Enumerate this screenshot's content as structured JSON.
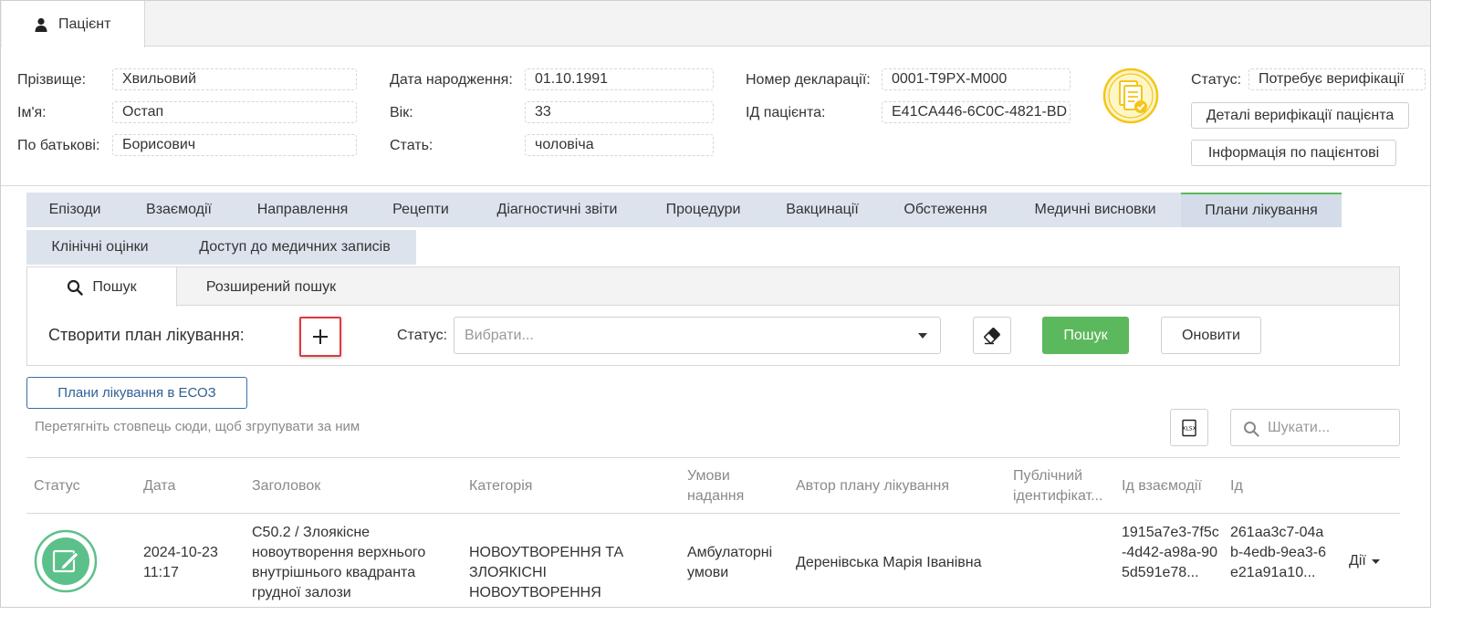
{
  "top_tab": {
    "label": "Пацієнт"
  },
  "patient": {
    "surname_label": "Прізвище:",
    "surname": "Хвильовий",
    "name_label": "Ім'я:",
    "name": "Остап",
    "patronymic_label": "По батькові:",
    "patronymic": "Борисович",
    "dob_label": "Дата народження:",
    "dob": "01.10.1991",
    "age_label": "Вік:",
    "age": "33",
    "sex_label": "Стать:",
    "sex": "чоловіча",
    "declaration_label": "Номер декларації:",
    "declaration": "0001-T9PX-M000",
    "patient_id_label": "ІД пацієнта:",
    "patient_id": "E41CA446-6C0C-4821-BD",
    "status_label": "Статус:",
    "status": "Потребує верифікації",
    "verification_details_button": "Деталі верифікації пацієнта",
    "patient_info_button": "Інформація по пацієнтові"
  },
  "section_tabs_row1": [
    "Епізоди",
    "Взаємодії",
    "Направлення",
    "Рецепти",
    "Діагностичні звіти",
    "Процедури",
    "Вакцинації",
    "Обстеження",
    "Медичні висновки",
    "Плани лікування"
  ],
  "section_tabs_row2": [
    "Клінічні оцінки",
    "Доступ до медичних записів"
  ],
  "active_section_tab": "Плани лікування",
  "search_panel": {
    "tab_search": "Пошук",
    "tab_advanced": "Розширений пошук",
    "create_label": "Створити план лікування:",
    "status_label": "Статус:",
    "status_placeholder": "Вибрати...",
    "search_button": "Пошук",
    "refresh_button": "Оновити"
  },
  "eso_button": "Плани лікування в ЕСОЗ",
  "group_hint": "Перетягніть стовпець сюди, щоб згрупувати за ним",
  "grid_search_placeholder": "Шукати...",
  "grid": {
    "columns": [
      "Статус",
      "Дата",
      "Заголовок",
      "Категорія",
      "Умови надання",
      "Автор плану лікування",
      "Публічний ідентифікат...",
      "Ід взаємодії",
      "Ід"
    ],
    "rows": [
      {
        "status_icon": "edit-icon",
        "date": "2024-10-23 11:17",
        "title": "C50.2 / Злоякісне новоутворення верхнього внутрішнього квадранта грудної залози",
        "category": "НОВОУТВОРЕННЯ ТА ЗЛОЯКІСНІ НОВОУТВОРЕННЯ",
        "conditions": "Амбулаторні умови",
        "author": "Деренівська Марія Іванівна",
        "public_id": "",
        "interaction_id": "1915a7e3-7f5c-4d42-a98a-905d591e78...",
        "id": "261aa3c7-04ab-4edb-9ea3-6e21a91a10...",
        "actions": "Дії"
      }
    ]
  },
  "colors": {
    "accent_green": "#5cb85c",
    "tab_bg": "#dce3ed",
    "button_blue": "#3a6ea5",
    "highlight_red": "#e0393e",
    "icon_gold": "#f5c518"
  }
}
